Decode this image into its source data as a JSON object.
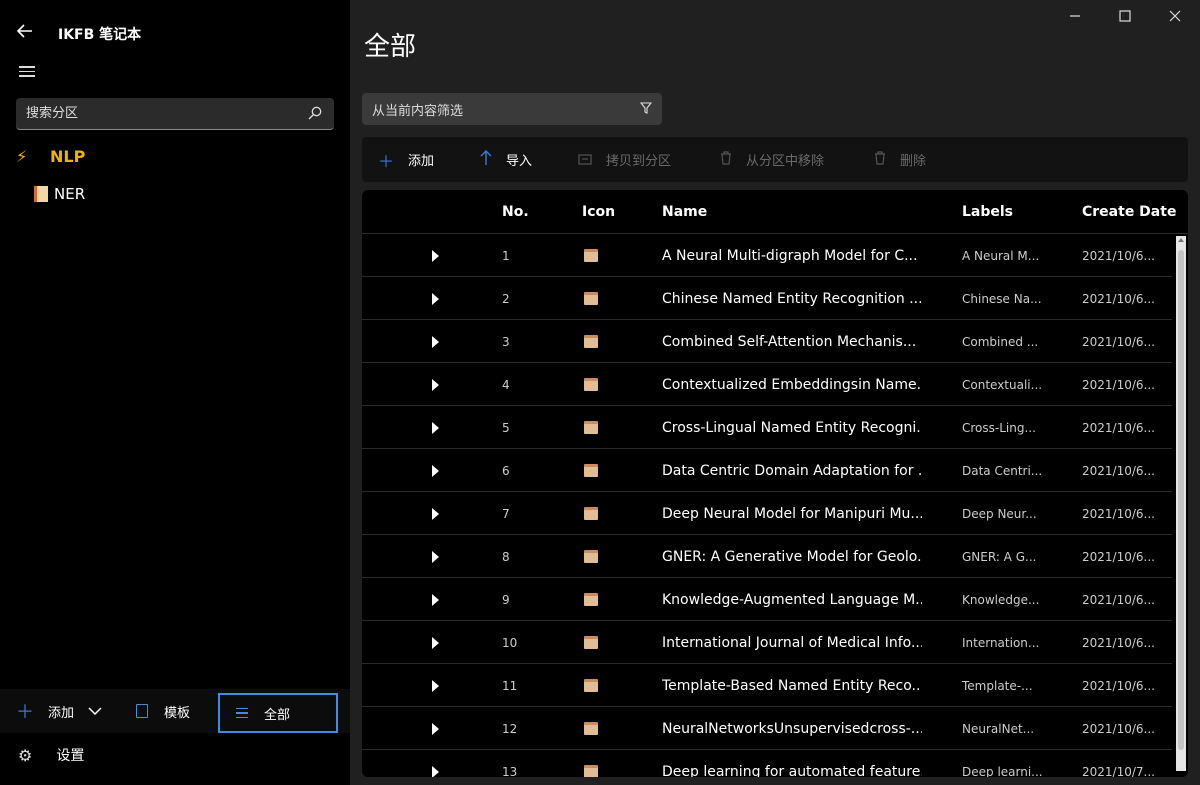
{
  "app": {
    "title": "IKFB 笔记本"
  },
  "sidebar": {
    "search_placeholder": "搜索分区",
    "tree": [
      {
        "label": "NLP"
      },
      {
        "label": "NER"
      }
    ],
    "bottom": {
      "add_label": "添加",
      "template_label": "模板",
      "all_label": "全部"
    },
    "settings_label": "设置"
  },
  "main": {
    "title": "全部",
    "filter_placeholder": "从当前内容筛选",
    "toolbar": {
      "add": "添加",
      "import": "导入",
      "copy_to": "拷贝到分区",
      "remove": "从分区中移除",
      "delete": "删除"
    },
    "table": {
      "headers": {
        "no": "No.",
        "icon": "Icon",
        "name": "Name",
        "labels": "Labels",
        "date": "Create Date"
      },
      "rows": [
        {
          "no": "1",
          "name": "A Neural Multi-digraph Model for C...",
          "label": "A Neural M...",
          "date": "2021/10/6..."
        },
        {
          "no": "2",
          "name": "Chinese Named Entity  Recognition ...",
          "label": "Chinese Na...",
          "date": "2021/10/6..."
        },
        {
          "no": "3",
          "name": "Combined Self-Attention Mechanis...",
          "label": "Combined ...",
          "date": "2021/10/6..."
        },
        {
          "no": "4",
          "name": "Contextualized Embeddingsin Name...",
          "label": "Contextuali...",
          "date": "2021/10/6..."
        },
        {
          "no": "5",
          "name": "Cross-Lingual Named Entity Recogni...",
          "label": "Cross-Ling...",
          "date": "2021/10/6..."
        },
        {
          "no": "6",
          "name": "Data Centric Domain Adaptation for ...",
          "label": "Data Centri...",
          "date": "2021/10/6..."
        },
        {
          "no": "7",
          "name": "Deep Neural Model for Manipuri Mu...",
          "label": "Deep Neur...",
          "date": "2021/10/6..."
        },
        {
          "no": "8",
          "name": "GNER: A Generative Model for Geolo...",
          "label": "GNER: A G...",
          "date": "2021/10/6..."
        },
        {
          "no": "9",
          "name": "Knowledge-Augmented Language M...",
          "label": "Knowledge...",
          "date": "2021/10/6..."
        },
        {
          "no": "10",
          "name": "International Journal of Medical Info...",
          "label": "Internation...",
          "date": "2021/10/6..."
        },
        {
          "no": "11",
          "name": "Template-Based Named Entity Reco...",
          "label": "Template-...",
          "date": "2021/10/6..."
        },
        {
          "no": "12",
          "name": "NeuralNetworksUnsupervisedcross-...",
          "label": "NeuralNet...",
          "date": "2021/10/6..."
        },
        {
          "no": "13",
          "name": "Deep learning for automated feature...",
          "label": "Deep learni...",
          "date": "2021/10/7..."
        }
      ]
    }
  },
  "colors": {
    "accent": "#3a8ee6",
    "section_highlight": "#f0b400",
    "background": "#202020",
    "sidebar": "#000000"
  }
}
